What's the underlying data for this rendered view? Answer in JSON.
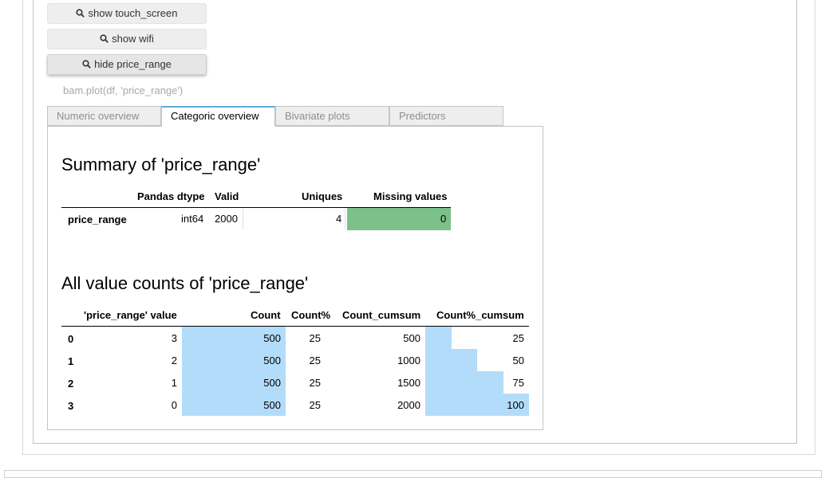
{
  "buttons": [
    {
      "label": "show touch_screen",
      "icon": "search-icon"
    },
    {
      "label": "show wifi",
      "icon": "search-icon"
    },
    {
      "label": "hide price_range",
      "icon": "search-icon"
    }
  ],
  "code_line": "bam.plot(df, 'price_range')",
  "tabs": [
    "Numeric overview",
    "Categoric overview",
    "Bivariate plots",
    "Predictors"
  ],
  "active_tab": "Categoric overview",
  "summary": {
    "title": "Summary of 'price_range'",
    "headers": [
      "Pandas dtype",
      "Valid",
      "Uniques",
      "Missing values"
    ],
    "row": {
      "name": "price_range",
      "dtype": "int64",
      "valid": "2000",
      "uniques": "4",
      "missing": "0"
    },
    "missing_color": "#7cc08a"
  },
  "value_counts": {
    "title": "All value counts of 'price_range'",
    "headers": [
      "'price_range' value",
      "Count",
      "Count%",
      "Count_cumsum",
      "Count%_cumsum"
    ],
    "rows": [
      {
        "index": "0",
        "value": "3",
        "count": "500",
        "pct": "25",
        "cumsum": "500",
        "pct_cumsum": "25"
      },
      {
        "index": "1",
        "value": "2",
        "count": "500",
        "pct": "25",
        "cumsum": "1000",
        "pct_cumsum": "50"
      },
      {
        "index": "2",
        "value": "1",
        "count": "500",
        "pct": "25",
        "cumsum": "1500",
        "pct_cumsum": "75"
      },
      {
        "index": "3",
        "value": "0",
        "count": "500",
        "pct": "25",
        "cumsum": "2000",
        "pct_cumsum": "100"
      }
    ],
    "count_bar_fraction": 1.0,
    "pct_cumsum_fractions": [
      0.25,
      0.5,
      0.75,
      1.0
    ],
    "bar_color": "#b3dcfa"
  },
  "colors": {
    "active_tab_accent": "#64a8d8"
  }
}
